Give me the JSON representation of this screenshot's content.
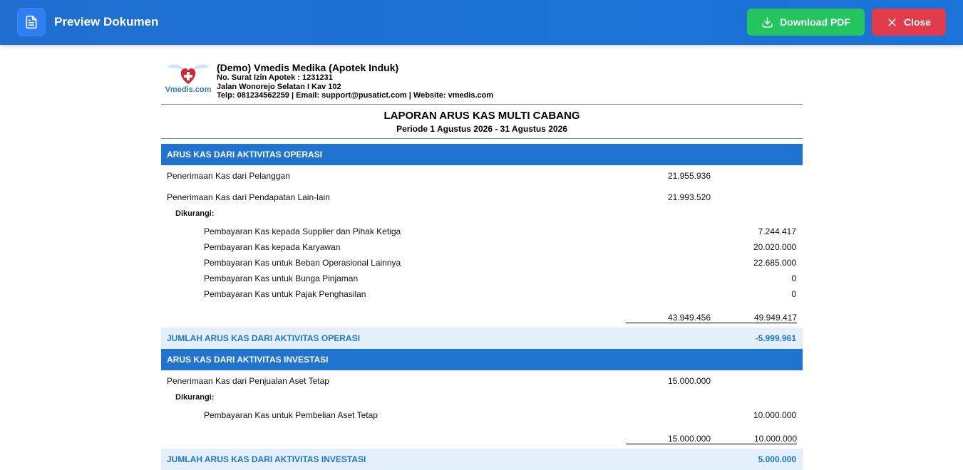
{
  "topbar": {
    "title": "Preview Dokumen",
    "download_label": "Download PDF",
    "close_label": "Close"
  },
  "company": {
    "logo_text": "Vmedis.com",
    "name": "(Demo) Vmedis Medika (Apotek Induk)",
    "license": "No. Surat Izin Apotek : 1231231",
    "address": "Jalan Wonorejo Selatan I Kav 102",
    "contact": "Telp: 081234562259 | Email: support@pusatict.com | Website: vmedis.com"
  },
  "report": {
    "title": "LAPORAN ARUS KAS MULTI CABANG",
    "period": "Periode 1 Agustus 2026 - 31 Agustus 2026"
  },
  "operasi": {
    "heading": "ARUS KAS DARI AKTIVITAS OPERASI",
    "receipts": [
      {
        "label": "Penerimaan Kas dari Pelanggan",
        "value": "21.955.936"
      },
      {
        "label": "Penerimaan Kas dari Pendapatan Lain-lain",
        "value": "21.993.520"
      }
    ],
    "deduct_label": "Dikurangi:",
    "payments": [
      {
        "label": "Pembayaran Kas kepada Supplier dan Pihak Ketiga",
        "value": "7.244.417"
      },
      {
        "label": "Pembayaran Kas kepada Karyawan",
        "value": "20.020.000"
      },
      {
        "label": "Pembayaran Kas untuk Beban Operasional Lainnya",
        "value": "22.685.000"
      },
      {
        "label": "Pembayaran Kas untuk Bunga Pinjaman",
        "value": "0"
      },
      {
        "label": "Pembayaran Kas untuk Pajak Penghasilan",
        "value": "0"
      }
    ],
    "total_receipts": "43.949.456",
    "total_payments": "49.949.417",
    "sum_label": "JUMLAH ARUS KAS DARI AKTIVITAS OPERASI",
    "sum_value": "-5.999.961"
  },
  "investasi": {
    "heading": "ARUS KAS DARI AKTIVITAS INVESTASI",
    "receipts": [
      {
        "label": "Penerimaan Kas dari Penjualan Aset Tetap",
        "value": "15.000.000"
      }
    ],
    "deduct_label": "Dikurangi:",
    "payments": [
      {
        "label": "Pembayaran Kas untuk Pembelian Aset Tetap",
        "value": "10.000.000"
      }
    ],
    "total_receipts": "15.000.000",
    "total_payments": "10.000.000",
    "sum_label": "JUMLAH ARUS KAS DARI AKTIVITAS INVESTASI",
    "sum_value": "5.000.000"
  },
  "colors": {
    "topbar": "#1f6fd0",
    "download": "#22c55e",
    "close": "#e23b4a",
    "section": "#1f74d1",
    "sum_bg": "#e3f0fb"
  }
}
